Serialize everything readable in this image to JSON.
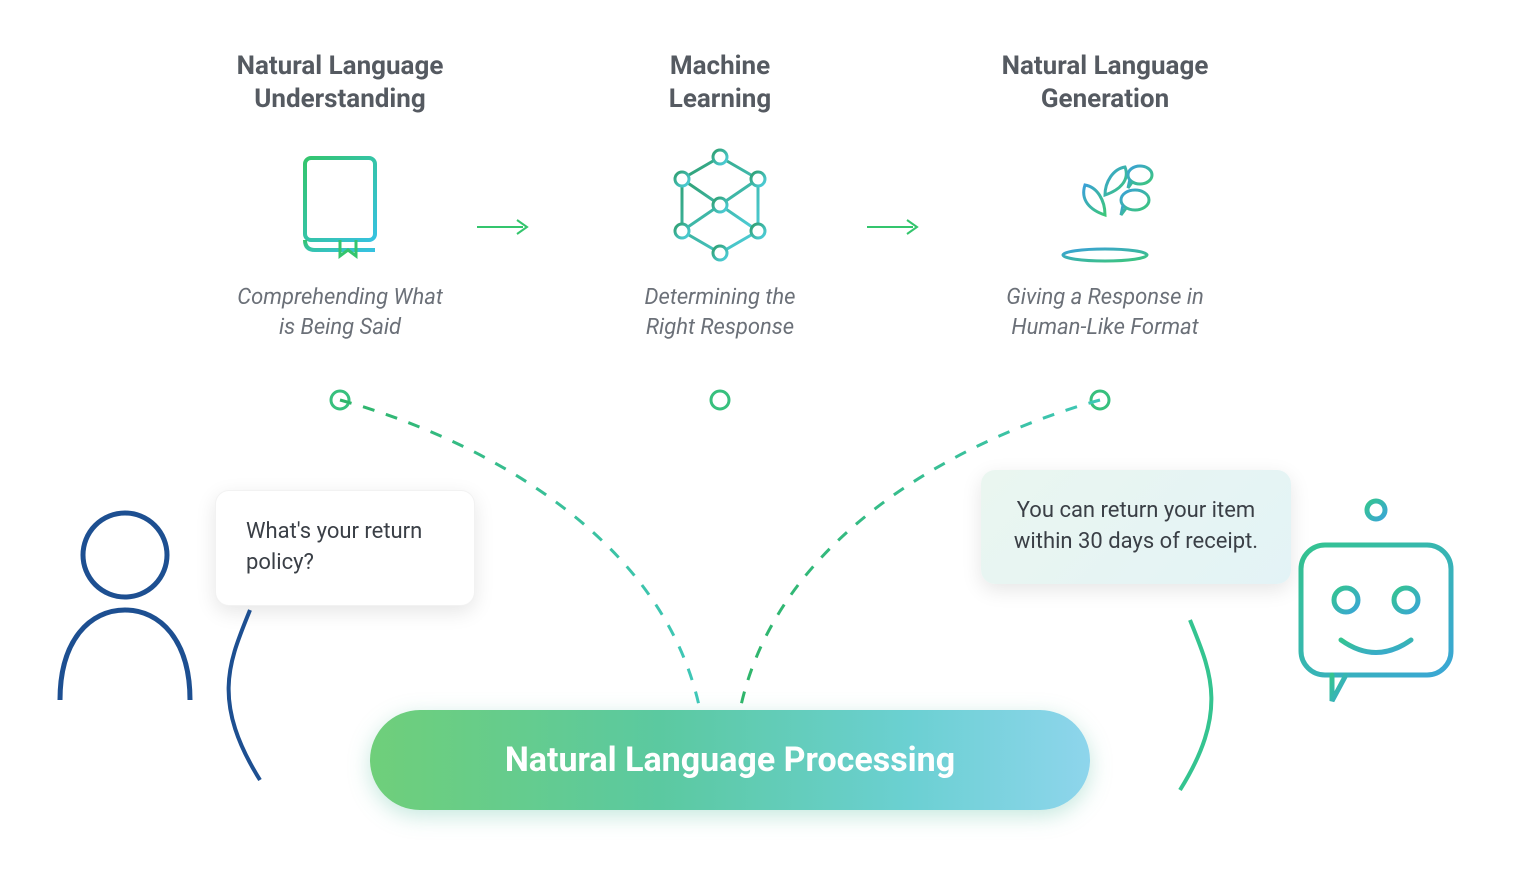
{
  "columns": [
    {
      "title_line1": "Natural Language",
      "title_line2": "Understanding",
      "desc_line1": "Comprehending What",
      "desc_line2": "is Being Said"
    },
    {
      "title_line1": "Machine",
      "title_line2": "Learning",
      "desc_line1": "Determining the",
      "desc_line2": "Right Response"
    },
    {
      "title_line1": "Natural Language",
      "title_line2": "Generation",
      "desc_line1": "Giving a Response in",
      "desc_line2": "Human-Like Format"
    }
  ],
  "user_message": "What's your return policy?",
  "bot_message": "You can return your item within 30 days of receipt.",
  "nlp_label": "Natural Language Processing",
  "colors": {
    "green": "#34c56d",
    "teal": "#36c2c8",
    "blue": "#1d4f91",
    "text": "#555a61"
  }
}
